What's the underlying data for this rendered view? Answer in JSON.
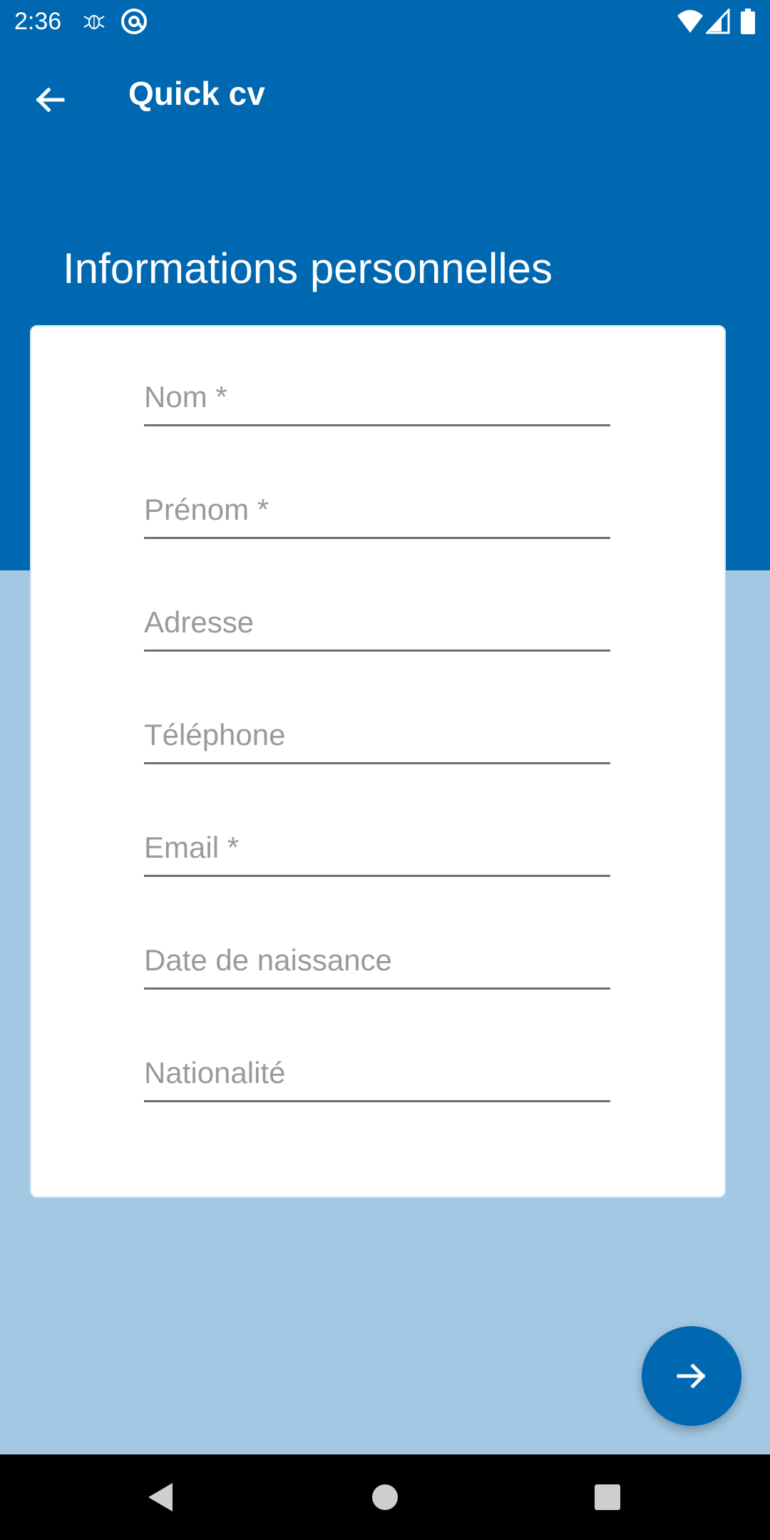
{
  "status_bar": {
    "time": "2:36",
    "left_icons": [
      "bug-icon",
      "at-sign-icon"
    ],
    "right_icons": [
      "wifi-icon",
      "cell-signal-icon",
      "battery-icon"
    ]
  },
  "app_bar": {
    "title": "Quick cv",
    "back_icon": "arrow-back-icon"
  },
  "section": {
    "title": "Informations personnelles"
  },
  "form": {
    "fields": [
      {
        "placeholder": "Nom *",
        "value": ""
      },
      {
        "placeholder": "Prénom *",
        "value": ""
      },
      {
        "placeholder": "Adresse",
        "value": ""
      },
      {
        "placeholder": "Téléphone",
        "value": ""
      },
      {
        "placeholder": "Email *",
        "value": ""
      },
      {
        "placeholder": "Date de naissance",
        "value": ""
      },
      {
        "placeholder": "Nationalité",
        "value": ""
      }
    ]
  },
  "fab": {
    "icon": "arrow-forward-icon"
  },
  "nav_bar": {
    "icons": [
      "nav-back-icon",
      "nav-home-icon",
      "nav-recents-icon"
    ]
  },
  "colors": {
    "primary": "#0068b0",
    "background": "#a2c8e4",
    "card": "#ffffff",
    "hint": "#9a9a9a",
    "underline": "#6e6e6e"
  }
}
